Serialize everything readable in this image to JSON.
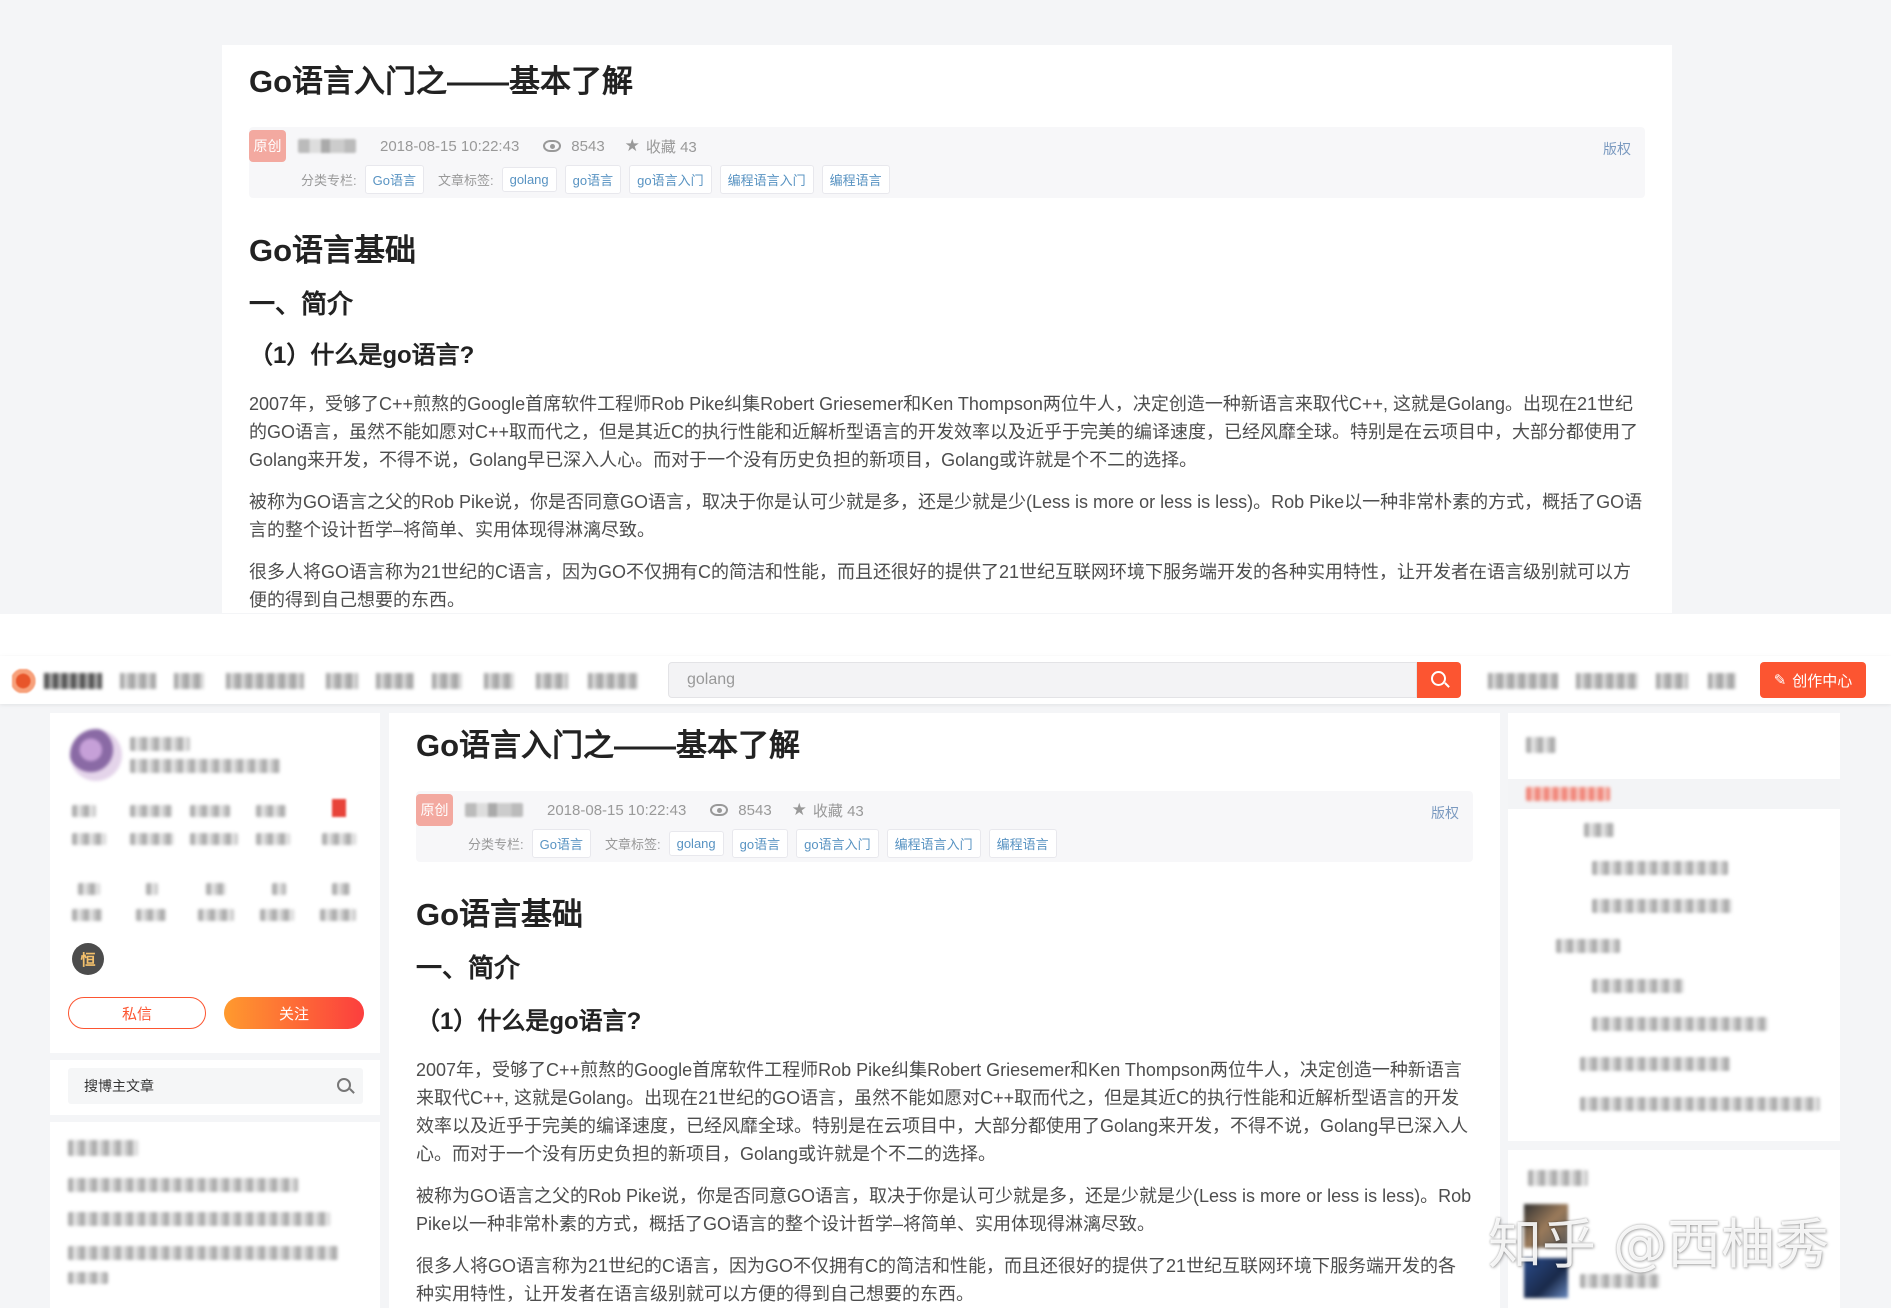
{
  "article": {
    "title": "Go语言入门之——基本了解",
    "badge": "原创",
    "date": "2018-08-15 10:22:43",
    "views": "8543",
    "favorites": "收藏 43",
    "copyright": "版权",
    "category_label": "分类专栏:",
    "category": "Go语言",
    "tags_label": "文章标签:",
    "tags": [
      "golang",
      "go语言",
      "go语言入门",
      "编程语言入门",
      "编程语言"
    ],
    "h1": "Go语言基础",
    "h2": "一、简介",
    "h3": "（1）什么是go语言?",
    "p1": "2007年，受够了C++煎熬的Google首席软件工程师Rob Pike纠集Robert Griesemer和Ken Thompson两位牛人，决定创造一种新语言来取代C++, 这就是Golang。出现在21世纪的GO语言，虽然不能如愿对C++取而代之，但是其近C的执行性能和近解析型语言的开发效率以及近乎于完美的编译速度，已经风靡全球。特别是在云项目中，大部分都使用了Golang来开发，不得不说，Golang早已深入人心。而对于一个没有历史负担的新项目，Golang或许就是个不二的选择。",
    "p2": "被称为GO语言之父的Rob Pike说，你是否同意GO语言，取决于你是认可少就是多，还是少就是少(Less is more or less is less)。Rob Pike以一种非常朴素的方式，概括了GO语言的整个设计哲学–将简单、实用体现得淋漓尽致。",
    "p3": "很多人将GO语言称为21世纪的C语言，因为GO不仅拥有C的简洁和性能，而且还很好的提供了21世纪互联网环境下服务端开发的各种实用特性，让开发者在语言级别就可以方便的得到自己想要的东西。"
  },
  "navbar": {
    "search_value": "golang",
    "create_label": "创作中心"
  },
  "sidebar": {
    "level_badge": "恒",
    "message_label": "私信",
    "follow_label": "关注",
    "search_placeholder": "搜博主文章"
  },
  "watermark": "知乎 @西柚秀",
  "colors": {
    "accent": "#fc5531",
    "tag_text": "#5893c2",
    "badge_bg": "#f3a9a0"
  }
}
